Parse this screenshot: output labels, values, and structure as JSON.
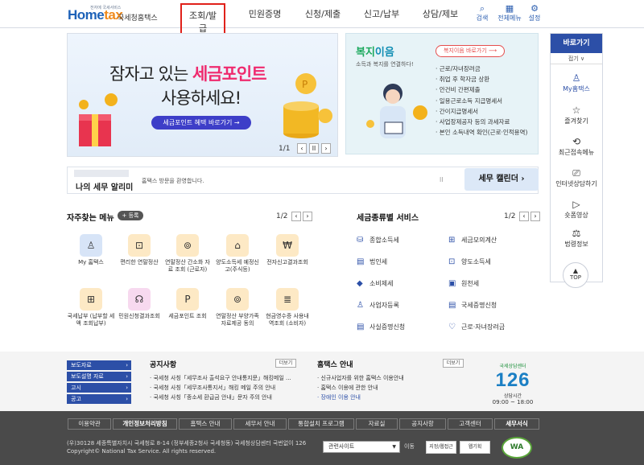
{
  "header": {
    "logo_text_a": "Home",
    "logo_text_b": "tax",
    "logo_tagline": "전자에 국세서비스",
    "logo_sub": "국세청홈택스",
    "nav": [
      "조회/발급",
      "민원증명",
      "신청/제출",
      "신고/납부",
      "상담/제보"
    ],
    "utils": [
      {
        "icon": "search-icon",
        "glyph": "⌕",
        "label": "검색"
      },
      {
        "icon": "grid-menu-icon",
        "glyph": "▦",
        "label": "전체메뉴"
      },
      {
        "icon": "gear-icon",
        "glyph": "⚙",
        "label": "설정"
      }
    ]
  },
  "banner": {
    "line1_a": "잠자고 있는 ",
    "line1_b": "세금포인트",
    "line2": "사용하세요!",
    "button": "세금포인트 혜택 바로가기  →",
    "pager": "1/1",
    "prev": "‹",
    "pause": "ll",
    "next": "›"
  },
  "welfare": {
    "title_a": "복지",
    "title_b": "이음",
    "subtitle": "소득과 복지를 연결하다!",
    "link": "복지이음 바로가기 ⟶",
    "items": [
      "근로/자녀장려금",
      "취업 후 학자금 상환",
      "안건비 간편제출",
      "일용근로소득 지급명세서",
      "간이지급명세서",
      "사업장제공자 등의 과세자료",
      "본인 소득내역 확인(근로·인적용역)"
    ]
  },
  "rail": {
    "header": "바로가기",
    "fold": "접기 ∨",
    "items": [
      {
        "icon": "person-icon",
        "glyph": "♙",
        "label": "My홈택스"
      },
      {
        "icon": "star-icon",
        "glyph": "☆",
        "label": "즐겨찾기"
      },
      {
        "icon": "recent-icon",
        "glyph": "⟲",
        "label": "최근접속메뉴"
      },
      {
        "icon": "monitor-icon",
        "glyph": "⎚",
        "label": "인터넷상담하기"
      },
      {
        "icon": "play-icon",
        "glyph": "▷",
        "label": "숏폼영상"
      },
      {
        "icon": "gavel-icon",
        "glyph": "⚖",
        "label": "법령정보"
      }
    ],
    "top": "TOP"
  },
  "strip": {
    "name": "나의 세무 알리미",
    "message": "홈택스 방문을 환영합니다.",
    "sep": "ll",
    "calendar": "세무 캘린더  ›"
  },
  "freq": {
    "title": "자주찾는 메뉴",
    "add": "+ 등록",
    "pager": "1/2",
    "prev": "‹",
    "next": "›",
    "tiles": [
      {
        "icon": "my-hometax-icon",
        "glyph": "♙",
        "label": "My 홈택스",
        "style": "blue"
      },
      {
        "icon": "easy-settlement-icon",
        "glyph": "⊡",
        "label": "편리한 연말정산",
        "style": ""
      },
      {
        "icon": "simple-data-icon",
        "glyph": "⊚",
        "label": "연말정산 간소화 자료 조회 (근로자)",
        "style": ""
      },
      {
        "icon": "house-icon",
        "glyph": "⌂",
        "label": "양도소득세 예정신고(주식등)",
        "style": ""
      },
      {
        "icon": "e-invoice-icon",
        "glyph": "₩",
        "label": "전자신고결과조회",
        "style": ""
      },
      {
        "icon": "tax-payment-icon",
        "glyph": "⊞",
        "label": "국세납부 (납부할 세액 조회납부)",
        "style": ""
      },
      {
        "icon": "headset-icon",
        "glyph": "☊",
        "label": "민원신청결과조회",
        "style": "pink"
      },
      {
        "icon": "tax-point-icon",
        "glyph": "P",
        "label": "세금포인트 조회",
        "style": ""
      },
      {
        "icon": "dependent-icon",
        "glyph": "⊚",
        "label": "연말정산 부양가족 자료제공 동의",
        "style": ""
      },
      {
        "icon": "cash-receipt-icon",
        "glyph": "≣",
        "label": "현금영수증 사용내역조회 (소비자)",
        "style": ""
      }
    ]
  },
  "taxes": {
    "title": "세금종류별 서비스",
    "pager": "1/2",
    "prev": "‹",
    "next": "›",
    "items": [
      {
        "icon": "income-tax-icon",
        "glyph": "⛁",
        "label": "종합소득세"
      },
      {
        "icon": "calculator-icon",
        "glyph": "⊞",
        "label": "세금모의계산"
      },
      {
        "icon": "corporate-tax-icon",
        "glyph": "▤",
        "label": "법인세"
      },
      {
        "icon": "transfer-tax-icon",
        "glyph": "⊡",
        "label": "양도소득세"
      },
      {
        "icon": "excise-tax-icon",
        "glyph": "◆",
        "label": "소비제세"
      },
      {
        "icon": "withholding-icon",
        "glyph": "▣",
        "label": "원천세"
      },
      {
        "icon": "business-reg-icon",
        "glyph": "♙",
        "label": "사업자등록"
      },
      {
        "icon": "certificate-icon",
        "glyph": "▤",
        "label": "국세증명신청"
      },
      {
        "icon": "fact-cert-icon",
        "glyph": "▤",
        "label": "사실증명신청"
      },
      {
        "icon": "heart-icon",
        "glyph": "♡",
        "label": "근로·자녀장려금"
      }
    ]
  },
  "band": {
    "side_buttons": [
      "보도자료",
      "보도설명 자료",
      "고시",
      "공고"
    ],
    "notice_title": "공지사항",
    "notice_more": "더보기",
    "notices": [
      "국세청 사칭「세무조사 출석요구 안내통지문」해킹메일 ...",
      "국세청 사칭「세무조사통지서」해킹 메일 주의 안내",
      "국세청 사칭「종소세 환급금 안내」문자 주의 안내"
    ],
    "guide_title": "홈택스 안내",
    "guide_more": "더보기",
    "guides": [
      "신규사업자를 위한 홈택스 이용안내",
      "홈택스 이용에 관한 안내",
      "장애인 이용 안내"
    ],
    "center_top": "국세상담센터",
    "center_num": "126",
    "center_label": "상담시간",
    "center_hours": "09:00 ~ 18:00"
  },
  "footer": {
    "links": [
      "이용약관",
      "개인정보처리방침",
      "홈택스 안내",
      "세무서 안내",
      "통합설치 프로그램",
      "자료실",
      "공지사항",
      "고객센터",
      "세무서식"
    ],
    "address": "(우)30128 세종특별자치시 국세청로 8-14 (정부세종2청사 국세청동) 국세청상담센터 국번없이 126",
    "copyright": "Copyright© National Tax Service. All rights reserved.",
    "select": "관련사이트",
    "move": "이동",
    "cert1": "지정/웹접근",
    "cert2": "웹기획",
    "wa": "WA"
  }
}
